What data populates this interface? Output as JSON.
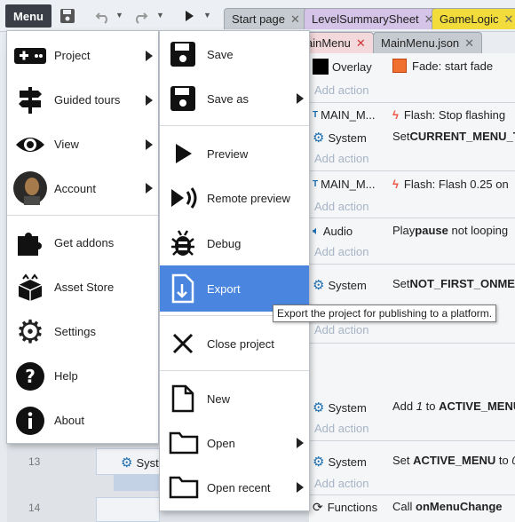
{
  "toolbar": {
    "menu_label": "Menu"
  },
  "tabs": [
    {
      "label": "Start page"
    },
    {
      "label": "LevelSummarySheet"
    },
    {
      "label": "GameLogic"
    },
    {
      "label": "ainMenu"
    },
    {
      "label": "MainMenu.json"
    }
  ],
  "main_menu": {
    "items": [
      {
        "label": "Project",
        "icon": "gamepad-icon"
      },
      {
        "label": "Guided tours",
        "icon": "signpost-icon"
      },
      {
        "label": "View",
        "icon": "eye-icon"
      },
      {
        "label": "Account",
        "icon": "avatar"
      },
      {
        "label": "Get addons",
        "icon": "puzzle-icon"
      },
      {
        "label": "Asset Store",
        "icon": "box-icon"
      },
      {
        "label": "Settings",
        "icon": "gear-icon"
      },
      {
        "label": "Help",
        "icon": "question-icon"
      },
      {
        "label": "About",
        "icon": "info-icon"
      }
    ]
  },
  "project_menu": {
    "items": [
      {
        "label": "Save"
      },
      {
        "label": "Save as"
      },
      {
        "label": "Preview"
      },
      {
        "label": "Remote preview"
      },
      {
        "label": "Debug"
      },
      {
        "label": "Export"
      },
      {
        "label": "Close project"
      },
      {
        "label": "New"
      },
      {
        "label": "Open"
      },
      {
        "label": "Open recent"
      }
    ]
  },
  "tooltip": {
    "text": "Export the project for publishing to a platform."
  },
  "sheet": {
    "add_action": "Add action",
    "line_13": "13",
    "line_14": "14",
    "left_system_13": "Syst",
    "events": {
      "overlay_obj": "Overlay",
      "fade_action": "Fade: start fade",
      "main_obj_1": "MAIN_M...",
      "flash_stop": "Flash: Stop flashing",
      "system_1": "System",
      "set_1_pre": "Set ",
      "set_1_bold": "CURRENT_MENU_TA",
      "main_obj_2": "MAIN_M...",
      "flash_025": "Flash: Flash 0.25 on",
      "audio": "Audio",
      "play_pre": "Play ",
      "play_bold": "pause",
      "play_post": " not looping",
      "system_2": "System",
      "set_2_pre": "Set ",
      "set_2_bold": "NOT_FIRST_ONMEN",
      "system_3": "System",
      "add_pre": "Add ",
      "add_num": "1",
      "add_to": " to ",
      "add_bold": "ACTIVE_MENU",
      "system_4": "System",
      "set_4_pre": "Set ",
      "set_4_bold": "ACTIVE_MENU",
      "set_4_to": " to ",
      "set_4_val": "0",
      "functions": "Functions",
      "call_pre": "Call ",
      "call_bold": "onMenuChange"
    }
  },
  "colors": {
    "accent": "#4a86e0",
    "menu_button": "#3a3f47",
    "gear": "#1f6fb0"
  }
}
